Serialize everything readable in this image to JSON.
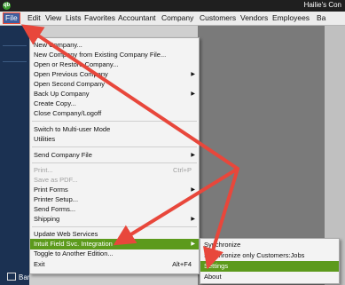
{
  "titlebar": {
    "logo": "qb",
    "title": "Hailie's Con"
  },
  "menubar": {
    "items": [
      "File",
      "Edit",
      "View",
      "Lists",
      "Favorites",
      "Accountant",
      "Company",
      "Customers",
      "Vendors",
      "Employees",
      "Ba"
    ]
  },
  "menu": {
    "items": [
      {
        "label": "New Company...",
        "shortcut": "",
        "submenu": false,
        "disabled": false
      },
      {
        "label": "New Company from Existing Company File...",
        "shortcut": "",
        "submenu": false,
        "disabled": false
      },
      {
        "label": "Open or Restore Company...",
        "shortcut": "",
        "submenu": false,
        "disabled": false
      },
      {
        "label": "Open Previous Company",
        "shortcut": "",
        "submenu": true,
        "disabled": false
      },
      {
        "label": "Open Second Company",
        "shortcut": "",
        "submenu": false,
        "disabled": false
      },
      {
        "label": "Back Up Company",
        "shortcut": "",
        "submenu": true,
        "disabled": false
      },
      {
        "label": "Create Copy...",
        "shortcut": "",
        "submenu": false,
        "disabled": false
      },
      {
        "label": "Close Company/Logoff",
        "shortcut": "",
        "submenu": false,
        "disabled": false
      },
      {
        "label": "Switch to Multi-user Mode",
        "shortcut": "",
        "submenu": false,
        "disabled": false
      },
      {
        "label": "Utilities",
        "shortcut": "",
        "submenu": false,
        "disabled": false
      },
      {
        "label": "Send Company File",
        "shortcut": "",
        "submenu": true,
        "disabled": false
      },
      {
        "label": "Print...",
        "shortcut": "Ctrl+P",
        "submenu": false,
        "disabled": true
      },
      {
        "label": "Save as PDF...",
        "shortcut": "",
        "submenu": false,
        "disabled": true
      },
      {
        "label": "Print Forms",
        "shortcut": "",
        "submenu": true,
        "disabled": false
      },
      {
        "label": "Printer Setup...",
        "shortcut": "",
        "submenu": false,
        "disabled": false
      },
      {
        "label": "Send Forms...",
        "shortcut": "",
        "submenu": false,
        "disabled": false
      },
      {
        "label": "Shipping",
        "shortcut": "",
        "submenu": true,
        "disabled": false
      },
      {
        "label": "Update Web Services",
        "shortcut": "",
        "submenu": false,
        "disabled": false
      },
      {
        "label": "Intuit Field Svc. Integration",
        "shortcut": "",
        "submenu": true,
        "disabled": false,
        "highlighted": true
      },
      {
        "label": "Toggle to Another Edition...",
        "shortcut": "",
        "submenu": false,
        "disabled": false
      },
      {
        "label": "Exit",
        "shortcut": "Alt+F4",
        "submenu": false,
        "disabled": false
      }
    ]
  },
  "submenu": {
    "items": [
      {
        "label": "Synchronize",
        "highlighted": false
      },
      {
        "label": "Synchronize only Customers:Jobs",
        "highlighted": false
      },
      {
        "label": "Settings",
        "highlighted": true
      },
      {
        "label": "About",
        "highlighted": false
      }
    ]
  },
  "sidebar": {
    "bank_feeds": "Bank Feeds"
  },
  "colors": {
    "highlight": "#5c9a1c",
    "arrow": "#e8473b",
    "sidebar": "#1b3152",
    "menubar_active": "#3f5f9f"
  },
  "icons": {
    "submenu_arrow": "triangle-right-icon",
    "bank": "bank-icon",
    "logo": "quickbooks-logo-icon"
  }
}
